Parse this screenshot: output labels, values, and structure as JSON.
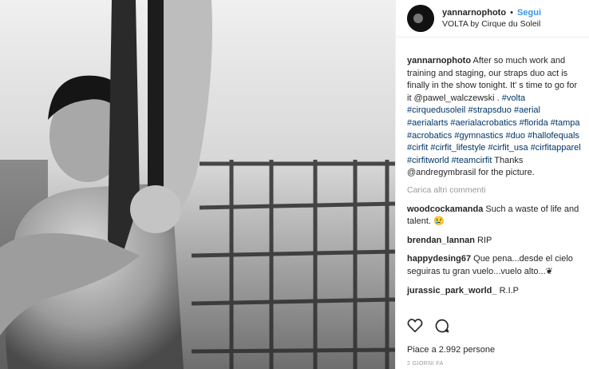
{
  "header": {
    "username": "yannarnophoto",
    "separator": "•",
    "follow_label": "Segui",
    "location": "VOLTA by Cirque du Soleil"
  },
  "caption": {
    "username": "yannarnophoto",
    "text": "After so much work and training and staging, our straps duo act is finally in the show tonight. It' s time to go for it @pawel_walczewski .",
    "hashtags": [
      "#volta",
      "#cirquedusoleil",
      "#strapsduo",
      "#aerial",
      "#aerialarts",
      "#aerialacrobatics",
      "#florida",
      "#tampa",
      "#acrobatics",
      "#gymnastics",
      "#duo",
      "#hallofequals",
      "#cirfit",
      "#cirfit_lifestyle",
      "#cirfit_usa",
      "#cirfitapparel",
      "#cirfitworld",
      "#teamcirfit"
    ],
    "thanks": "Thanks @andregymbrasil for the picture."
  },
  "load_more": "Carica altri commenti",
  "comments": [
    {
      "username": "woodcockamanda",
      "text": "Such a waste of life and talent. 😢"
    },
    {
      "username": "brendan_lannan",
      "text": "RIP"
    },
    {
      "username": "happydesing67",
      "text": "Que pena...desde el cielo seguiras tu gran vuelo...vuelo alto...❦"
    },
    {
      "username": "jurassic_park_world_",
      "text": "R.I.P"
    }
  ],
  "actions": {
    "like_icon": "heart-icon",
    "comment_icon": "comment-icon"
  },
  "likes": "Piace a 2.992 persone",
  "time_ago": "2 GIORNI FA",
  "colors": {
    "link": "#003569",
    "follow": "#3897f0",
    "muted": "#999999"
  }
}
